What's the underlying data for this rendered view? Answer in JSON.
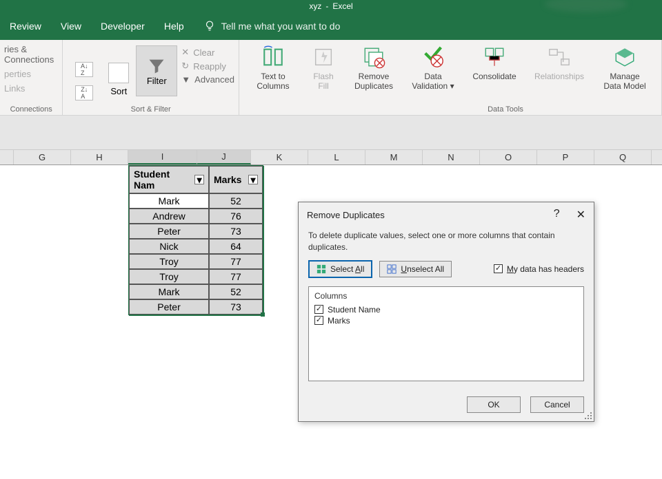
{
  "title": {
    "doc": "xyz",
    "app": "Excel"
  },
  "tabs": {
    "review": "Review",
    "view": "View",
    "developer": "Developer",
    "help": "Help",
    "tell": "Tell me what you want to do"
  },
  "ribbon": {
    "connections": {
      "queries": "ries & Connections",
      "properties": "perties",
      "links": "Links",
      "label": "Connections"
    },
    "sortfilter": {
      "sort": "Sort",
      "filter": "Filter",
      "clear": "Clear",
      "reapply": "Reapply",
      "advanced": "Advanced",
      "label": "Sort & Filter"
    },
    "datatools": {
      "textcols": "Text to\nColumns",
      "flash": "Flash\nFill",
      "remove": "Remove\nDuplicates",
      "validation": "Data\nValidation",
      "consolidate": "Consolidate",
      "relationships": "Relationships",
      "manage": "Manage\nData Model",
      "label": "Data Tools"
    }
  },
  "columns": [
    "G",
    "H",
    "I",
    "J",
    "K",
    "L",
    "M",
    "N",
    "O",
    "P",
    "Q"
  ],
  "table": {
    "headers": [
      "Student Nam",
      "Marks"
    ],
    "rows": [
      [
        "Mark",
        "52"
      ],
      [
        "Andrew",
        "76"
      ],
      [
        "Peter",
        "73"
      ],
      [
        "Nick",
        "64"
      ],
      [
        "Troy",
        "77"
      ],
      [
        "Troy",
        "77"
      ],
      [
        "Mark",
        "52"
      ],
      [
        "Peter",
        "73"
      ]
    ]
  },
  "dialog": {
    "title": "Remove Duplicates",
    "instruction": "To delete duplicate values, select one or more columns that contain duplicates.",
    "select_all": "Select All",
    "unselect_all": "Unselect All",
    "headers_check": "My data has headers",
    "columns_label": "Columns",
    "col_items": [
      "Student Name",
      "Marks"
    ],
    "ok": "OK",
    "cancel": "Cancel"
  }
}
